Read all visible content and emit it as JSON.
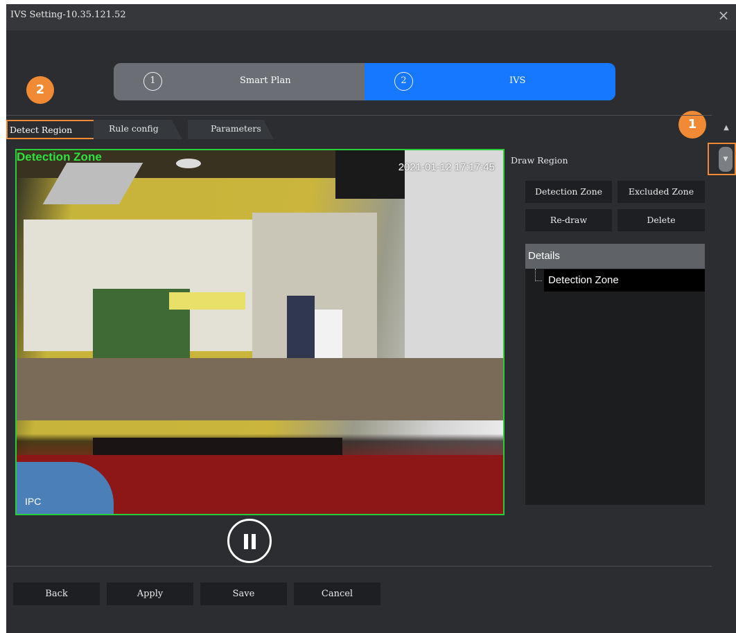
{
  "window": {
    "title": "IVS Setting-10.35.121.52",
    "close_icon": "×"
  },
  "stepper": {
    "steps": [
      {
        "number": "1",
        "label": "Smart Plan"
      },
      {
        "number": "2",
        "label": "IVS"
      }
    ],
    "active_color": "#1677ff"
  },
  "markers": {
    "one": "1",
    "two": "2",
    "color": "#f08a34"
  },
  "tabs": [
    {
      "label": "Detect Region"
    },
    {
      "label": "Rule config"
    },
    {
      "label": "Parameters"
    }
  ],
  "scroll": {
    "up_icon": "▲",
    "down_icon": "▼"
  },
  "video": {
    "zone_label": "Detection Zone",
    "timestamp": "2021-01-12 17:17:45",
    "camera_label": "IPC"
  },
  "draw_region": {
    "title": "Draw Region",
    "buttons": {
      "detection_zone": "Detection Zone",
      "excluded_zone": "Excluded Zone",
      "redraw": "Re-draw",
      "delete": "Delete"
    }
  },
  "details": {
    "header": "Details",
    "items": [
      "Detection Zone"
    ]
  },
  "footer": {
    "back": "Back",
    "apply": "Apply",
    "save": "Save",
    "cancel": "Cancel"
  }
}
